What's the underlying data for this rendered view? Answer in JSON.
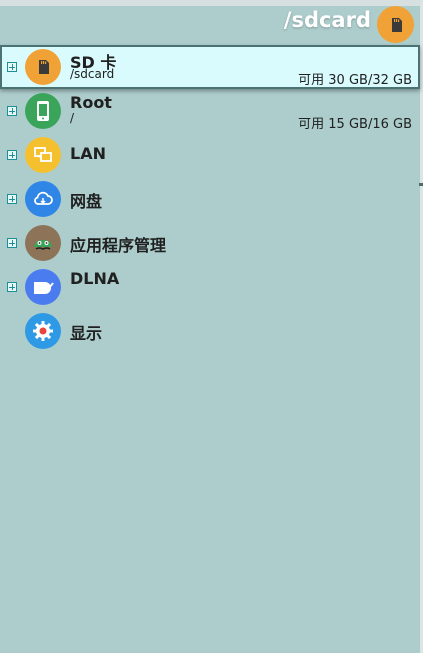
{
  "header": {
    "title": "/sdcard",
    "icon": "sd-card-icon",
    "icon_color": "#f0a236"
  },
  "items": [
    {
      "label": "SD 卡",
      "sub": "/sdcard",
      "space": "可用 30 GB/32 GB",
      "icon": "sd-card-icon",
      "color": "#f0a236",
      "selected": true
    },
    {
      "label": "Root",
      "sub": "/",
      "space": "可用 15 GB/16 GB",
      "icon": "phone-icon",
      "color": "#3aa55a"
    },
    {
      "label": "LAN",
      "icon": "lan-icon",
      "color": "#f5c02e"
    },
    {
      "label": "网盘",
      "icon": "cloud-icon",
      "color": "#2f86e6"
    },
    {
      "label": "应用程序管理",
      "icon": "app-manager-icon",
      "color": "#8d7458"
    },
    {
      "label": "DLNA",
      "icon": "dlna-icon",
      "color": "#4a7cf0"
    },
    {
      "label": "显示",
      "icon": "gear-icon",
      "color": "#2e9ae6"
    }
  ]
}
